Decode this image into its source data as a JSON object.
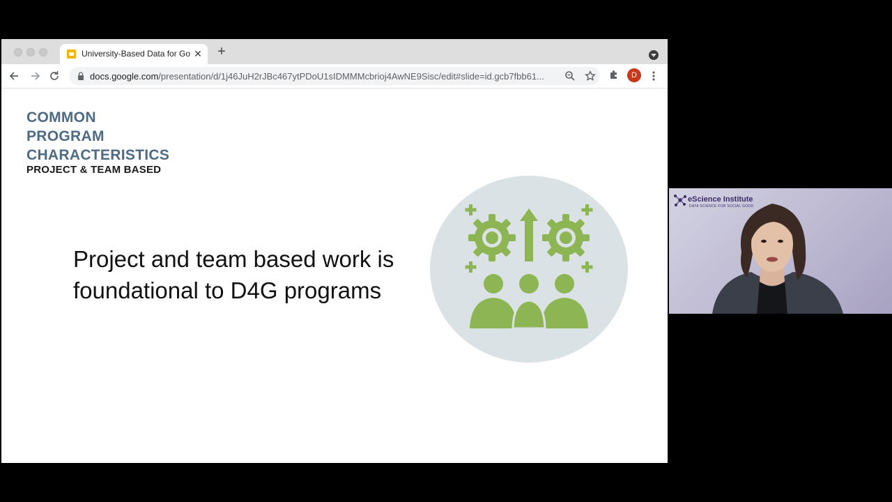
{
  "browser": {
    "tab_title": "University-Based Data for Goo",
    "tab_close": "✕",
    "new_tab": "+",
    "url_host": "docs.google.com",
    "url_path": "/presentation/d/1j46JuH2rJBc467ytPDoU1sIDMMMcbrioj4AwNE9Sisc/edit#slide=id.gcb7fbb61...",
    "avatar_initial": "D",
    "icons": [
      "back-icon",
      "forward-icon",
      "reload-icon",
      "lock-icon",
      "zoom-icon",
      "star-icon",
      "extensions-icon",
      "menu-icon"
    ]
  },
  "slide": {
    "heading_lines": [
      "COMMON",
      "PROGRAM",
      "CHARACTERISTICS"
    ],
    "subheading": "PROJECT & TEAM BASED",
    "body_lines": [
      "Project and team based work is",
      "foundational to D4G programs"
    ],
    "graphic": "teamwork-gears-icon"
  },
  "webcam": {
    "logo_title": "eScience Institute",
    "logo_tagline": "DATA SCIENCE FOR SOCIAL GOOD"
  },
  "colors": {
    "heading": "#4d6b85",
    "icon_green": "#8db553",
    "circle": "#dbe2e6"
  }
}
